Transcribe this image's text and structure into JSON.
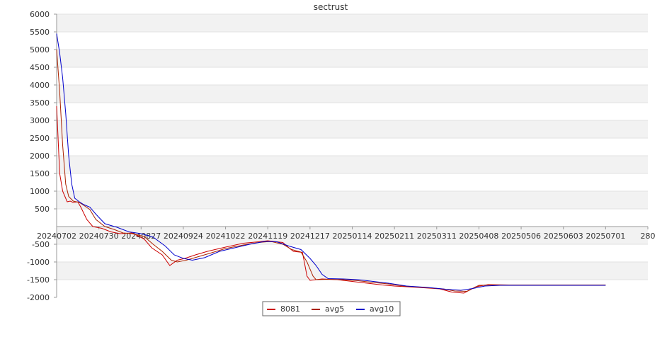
{
  "chart_data": {
    "type": "line",
    "title": "sectrust",
    "xlabel": "",
    "ylabel": "",
    "ylim": [
      -2000,
      6000
    ],
    "y_ticks": [
      -2000,
      -1500,
      -1000,
      -500,
      500,
      1000,
      1500,
      2000,
      2500,
      3000,
      3500,
      4000,
      4500,
      5000,
      5500,
      6000
    ],
    "x_ticks": [
      "20240702",
      "20240730",
      "20240827",
      "20240924",
      "20241022",
      "20241119",
      "20241217",
      "20250114",
      "20250211",
      "20250311",
      "20250408",
      "20250506",
      "20250603",
      "20250701",
      "280"
    ],
    "x_tick_days": [
      0,
      28,
      56,
      84,
      112,
      140,
      168,
      196,
      224,
      252,
      280,
      308,
      336,
      364,
      392
    ],
    "grid": "horizontal bands",
    "legend_position": "bottom-center",
    "series": [
      {
        "name": "8081",
        "color": "#cc0000",
        "points": [
          [
            0,
            3400
          ],
          [
            2,
            1500
          ],
          [
            4,
            1000
          ],
          [
            7,
            700
          ],
          [
            9,
            720
          ],
          [
            11,
            680
          ],
          [
            14,
            700
          ],
          [
            16,
            550
          ],
          [
            20,
            200
          ],
          [
            24,
            0
          ],
          [
            30,
            -50
          ],
          [
            36,
            -150
          ],
          [
            42,
            -200
          ],
          [
            50,
            -180
          ],
          [
            58,
            -350
          ],
          [
            63,
            -600
          ],
          [
            70,
            -800
          ],
          [
            75,
            -1100
          ],
          [
            80,
            -950
          ],
          [
            85,
            -900
          ],
          [
            92,
            -800
          ],
          [
            100,
            -700
          ],
          [
            112,
            -580
          ],
          [
            124,
            -470
          ],
          [
            134,
            -430
          ],
          [
            140,
            -400
          ],
          [
            150,
            -450
          ],
          [
            154,
            -600
          ],
          [
            157,
            -700
          ],
          [
            163,
            -730
          ],
          [
            166,
            -1400
          ],
          [
            168,
            -1520
          ],
          [
            176,
            -1480
          ],
          [
            186,
            -1500
          ],
          [
            196,
            -1550
          ],
          [
            206,
            -1600
          ],
          [
            216,
            -1650
          ],
          [
            224,
            -1680
          ],
          [
            240,
            -1720
          ],
          [
            254,
            -1760
          ],
          [
            262,
            -1850
          ],
          [
            270,
            -1880
          ],
          [
            278,
            -1700
          ],
          [
            286,
            -1640
          ],
          [
            300,
            -1650
          ],
          [
            330,
            -1650
          ],
          [
            364,
            -1650
          ]
        ]
      },
      {
        "name": "avg5",
        "color": "#aa2200",
        "points": [
          [
            0,
            5000
          ],
          [
            2,
            3800
          ],
          [
            4,
            2300
          ],
          [
            6,
            1200
          ],
          [
            8,
            850
          ],
          [
            11,
            720
          ],
          [
            15,
            680
          ],
          [
            18,
            600
          ],
          [
            22,
            480
          ],
          [
            26,
            200
          ],
          [
            32,
            0
          ],
          [
            38,
            -80
          ],
          [
            44,
            -180
          ],
          [
            50,
            -200
          ],
          [
            58,
            -280
          ],
          [
            64,
            -500
          ],
          [
            70,
            -700
          ],
          [
            76,
            -950
          ],
          [
            80,
            -1000
          ],
          [
            86,
            -950
          ],
          [
            94,
            -850
          ],
          [
            102,
            -750
          ],
          [
            112,
            -620
          ],
          [
            124,
            -520
          ],
          [
            134,
            -450
          ],
          [
            142,
            -420
          ],
          [
            150,
            -500
          ],
          [
            156,
            -650
          ],
          [
            162,
            -720
          ],
          [
            166,
            -1000
          ],
          [
            170,
            -1400
          ],
          [
            172,
            -1500
          ],
          [
            180,
            -1490
          ],
          [
            190,
            -1500
          ],
          [
            200,
            -1530
          ],
          [
            210,
            -1580
          ],
          [
            220,
            -1620
          ],
          [
            230,
            -1680
          ],
          [
            244,
            -1720
          ],
          [
            256,
            -1760
          ],
          [
            264,
            -1820
          ],
          [
            272,
            -1830
          ],
          [
            280,
            -1660
          ],
          [
            290,
            -1650
          ],
          [
            320,
            -1650
          ],
          [
            364,
            -1650
          ]
        ]
      },
      {
        "name": "avg10",
        "color": "#0000cc",
        "points": [
          [
            0,
            5450
          ],
          [
            2,
            4900
          ],
          [
            4,
            4200
          ],
          [
            6,
            3200
          ],
          [
            8,
            2000
          ],
          [
            10,
            1200
          ],
          [
            12,
            800
          ],
          [
            15,
            700
          ],
          [
            18,
            620
          ],
          [
            22,
            550
          ],
          [
            26,
            350
          ],
          [
            32,
            80
          ],
          [
            40,
            -20
          ],
          [
            48,
            -150
          ],
          [
            56,
            -200
          ],
          [
            64,
            -300
          ],
          [
            72,
            -550
          ],
          [
            78,
            -800
          ],
          [
            84,
            -900
          ],
          [
            90,
            -950
          ],
          [
            98,
            -880
          ],
          [
            108,
            -700
          ],
          [
            118,
            -600
          ],
          [
            128,
            -500
          ],
          [
            138,
            -420
          ],
          [
            146,
            -430
          ],
          [
            154,
            -550
          ],
          [
            162,
            -650
          ],
          [
            168,
            -900
          ],
          [
            172,
            -1100
          ],
          [
            176,
            -1350
          ],
          [
            180,
            -1470
          ],
          [
            190,
            -1480
          ],
          [
            200,
            -1500
          ],
          [
            210,
            -1550
          ],
          [
            220,
            -1600
          ],
          [
            232,
            -1680
          ],
          [
            246,
            -1720
          ],
          [
            258,
            -1770
          ],
          [
            268,
            -1800
          ],
          [
            276,
            -1750
          ],
          [
            284,
            -1680
          ],
          [
            294,
            -1660
          ],
          [
            330,
            -1660
          ],
          [
            364,
            -1660
          ]
        ]
      }
    ]
  }
}
